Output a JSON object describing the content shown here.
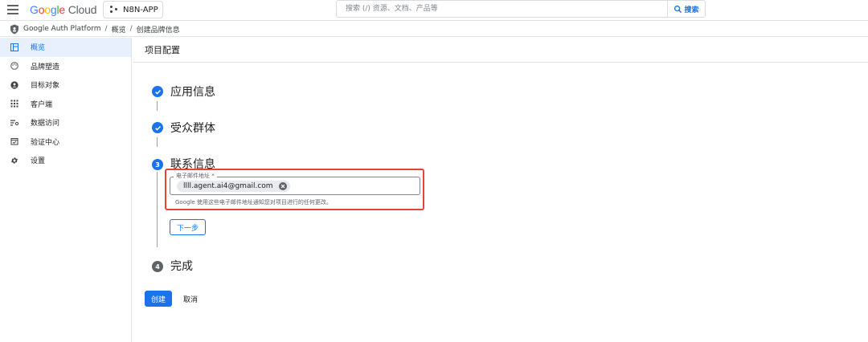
{
  "header": {
    "logo_google": "Google",
    "logo_cloud": "Cloud",
    "project_name": "N8N-APP",
    "search_placeholder": "搜索 (/) 资源、文档、产品等",
    "search_button": "搜索"
  },
  "breadcrumb": {
    "items": [
      "Google Auth Platform",
      "概览",
      "创建品牌信息"
    ],
    "separator": "/"
  },
  "sidebar": {
    "items": [
      {
        "label": "概览",
        "icon": "dashboard-icon",
        "active": true
      },
      {
        "label": "品牌塑造",
        "icon": "palette-icon",
        "active": false
      },
      {
        "label": "目标对象",
        "icon": "person-circle-icon",
        "active": false
      },
      {
        "label": "客户端",
        "icon": "grid-dots-icon",
        "active": false
      },
      {
        "label": "数据访问",
        "icon": "filter-list-icon",
        "active": false
      },
      {
        "label": "验证中心",
        "icon": "checkbox-calendar-icon",
        "active": false
      },
      {
        "label": "设置",
        "icon": "gear-icon",
        "active": false
      }
    ]
  },
  "main": {
    "title": "项目配置",
    "steps": [
      {
        "label": "应用信息",
        "state": "done"
      },
      {
        "label": "受众群体",
        "state": "done"
      },
      {
        "label": "联系信息",
        "state": "current",
        "number": "3"
      },
      {
        "label": "完成",
        "state": "pending",
        "number": "4"
      }
    ],
    "email_field": {
      "label": "电子邮件地址 *",
      "chip_value": "llll.agent.ai4@gmail.com",
      "helper": "Google 使用这些电子邮件地址通知您对项目进行的任何更改。"
    },
    "next_button": "下一步",
    "create_button": "创建",
    "cancel_button": "取消"
  },
  "colors": {
    "accent": "#1a73e8",
    "highlight": "#ea4335",
    "active_bg": "#e8f0fe"
  }
}
